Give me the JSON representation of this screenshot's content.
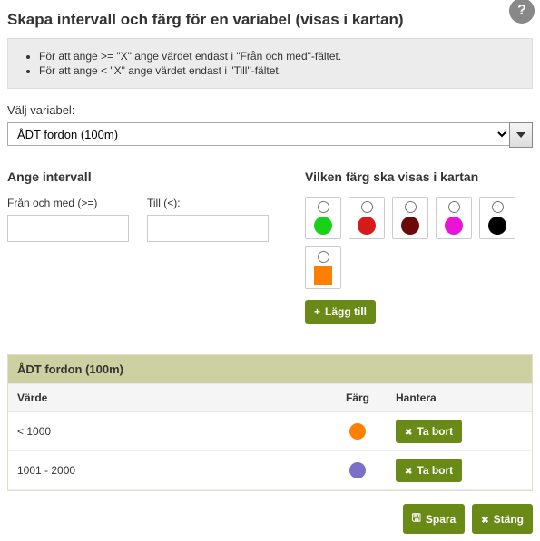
{
  "title": "Skapa intervall och färg för en variabel (visas i kartan)",
  "help": "?",
  "info": {
    "line1": "För att ange >= \"X\" ange värdet endast i \"Från och med\"-fältet.",
    "line2": "För att ange < \"X\" ange värdet endast i \"Till\"-fältet."
  },
  "variable": {
    "label": "Välj variabel:",
    "selected": "ÅDT fordon (100m)"
  },
  "interval": {
    "heading": "Ange intervall",
    "from_label": "Från och med (>=)",
    "to_label": "Till (<):",
    "from_value": "",
    "to_value": ""
  },
  "colors": {
    "heading": "Vilken färg ska visas i kartan",
    "add_label": "Lägg till",
    "swatches": [
      {
        "name": "green",
        "hex": "#18d118",
        "shape": "circle"
      },
      {
        "name": "red",
        "hex": "#d81919",
        "shape": "circle"
      },
      {
        "name": "darkred",
        "hex": "#6c0808",
        "shape": "circle"
      },
      {
        "name": "magenta",
        "hex": "#e815d8",
        "shape": "circle"
      },
      {
        "name": "black",
        "hex": "#000000",
        "shape": "circle"
      },
      {
        "name": "orange",
        "hex": "#ff7f00",
        "shape": "square"
      }
    ]
  },
  "table": {
    "title": "ÅDT fordon (100m)",
    "head": {
      "value": "Värde",
      "color": "Färg",
      "manage": "Hantera"
    },
    "remove_label": "Ta bort",
    "rows": [
      {
        "value": "< 1000",
        "color": "#ff7f00"
      },
      {
        "value": "1001 - 2000",
        "color": "#7b6fc9"
      }
    ]
  },
  "footer": {
    "save": "Spara",
    "close": "Stäng"
  }
}
